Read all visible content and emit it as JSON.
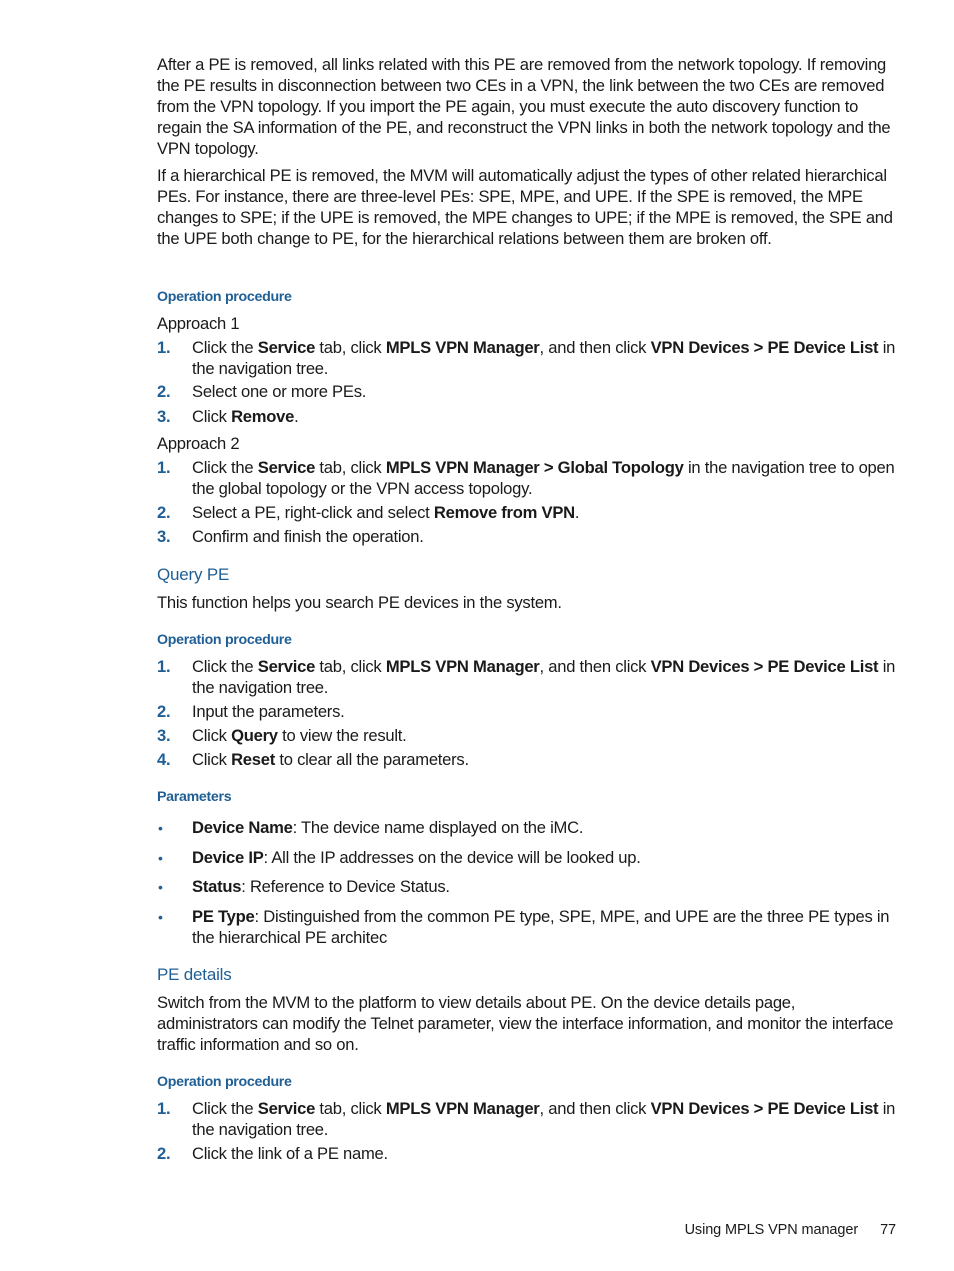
{
  "intro": {
    "para1": "After a PE is removed, all links related with this PE are removed from the network topology. If removing the PE results in disconnection between two CEs in a VPN, the link between the two CEs are removed from the VPN topology. If you import the PE again, you must execute the auto discovery function to regain the SA information of the PE, and reconstruct the VPN links in both the network topology and the VPN topology.",
    "para2": "If a hierarchical PE is removed, the MVM will automatically adjust the types of other related hierarchical PEs. For instance, there are three-level PEs: SPE, MPE, and UPE. If the SPE is removed, the MPE changes to SPE; if the UPE is removed, the MPE changes to UPE; if the MPE is removed, the SPE and the UPE both change to PE, for the hierarchical relations between them are broken off."
  },
  "remove_procedure": {
    "heading": "Operation procedure",
    "approach1": {
      "label": "Approach 1",
      "steps": [
        {
          "num": "1.",
          "parts": [
            "Click the ",
            "Service",
            " tab, click ",
            "MPLS VPN Manager",
            ", and then click ",
            "VPN Devices > PE Device List",
            " in the navigation tree."
          ]
        },
        {
          "num": "2.",
          "parts": [
            "Select one or more PEs."
          ]
        },
        {
          "num": "3.",
          "parts": [
            "Click ",
            "Remove",
            "."
          ]
        }
      ]
    },
    "approach2": {
      "label": "Approach 2",
      "steps": [
        {
          "num": "1.",
          "parts": [
            "Click the ",
            "Service",
            " tab, click ",
            "MPLS VPN Manager > Global Topology",
            " in the navigation tree to open the global topology or the VPN access topology."
          ]
        },
        {
          "num": "2.",
          "parts": [
            "Select a PE, right-click and select ",
            "Remove from VPN",
            "."
          ]
        },
        {
          "num": "3.",
          "parts": [
            "Confirm and finish the operation."
          ]
        }
      ]
    }
  },
  "query_pe": {
    "title": "Query PE",
    "description": "This function helps you search PE devices in the system.",
    "procedure_heading": "Operation procedure",
    "steps": [
      {
        "num": "1.",
        "parts": [
          "Click the ",
          "Service",
          " tab, click ",
          "MPLS VPN Manager",
          ", and then click ",
          "VPN Devices > PE Device List",
          " in the navigation tree."
        ]
      },
      {
        "num": "2.",
        "parts": [
          "Input the parameters."
        ]
      },
      {
        "num": "3.",
        "parts": [
          "Click ",
          "Query",
          " to view the result."
        ]
      },
      {
        "num": "4.",
        "parts": [
          "Click ",
          "Reset",
          " to clear all the parameters."
        ]
      }
    ],
    "parameters_heading": "Parameters",
    "parameters": [
      {
        "parts": [
          "Device Name",
          ": The device name displayed on the iMC."
        ]
      },
      {
        "parts": [
          "Device IP",
          ": All the IP addresses on the device will be looked up."
        ]
      },
      {
        "parts": [
          "Status",
          ": Reference to Device Status."
        ]
      },
      {
        "parts": [
          "PE Type",
          ": Distinguished from the common PE type, SPE, MPE, and UPE are the three PE types in the hierarchical PE architec"
        ]
      }
    ]
  },
  "pe_details": {
    "title": "PE details",
    "description": "Switch from the MVM to the platform to view details about PE. On the device details page, administrators can modify the Telnet parameter, view the interface information, and monitor the interface traffic information and so on.",
    "procedure_heading": "Operation procedure",
    "steps": [
      {
        "num": "1.",
        "parts": [
          "Click the ",
          "Service",
          " tab, click ",
          "MPLS VPN Manager",
          ", and then click ",
          "VPN Devices > PE Device List",
          " in the navigation tree."
        ]
      },
      {
        "num": "2.",
        "parts": [
          "Click the link of a PE name."
        ]
      }
    ]
  },
  "footer": {
    "section": "Using MPLS VPN manager",
    "page_number": "77"
  },
  "colors": {
    "heading_blue": "#1f5f95",
    "body_text": "#1a1a1a"
  }
}
